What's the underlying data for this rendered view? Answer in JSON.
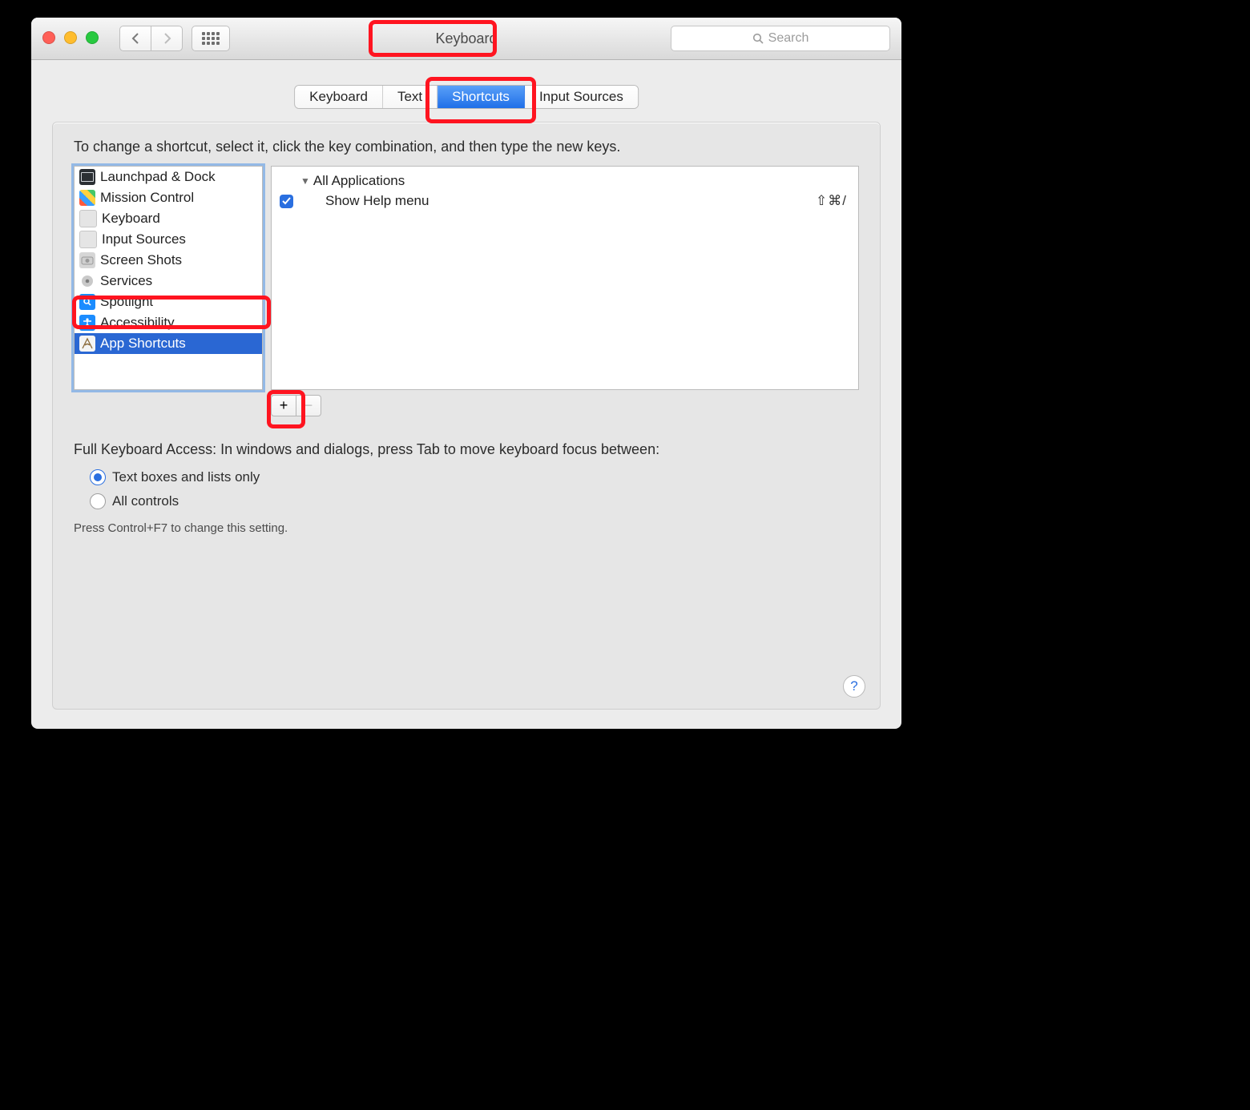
{
  "window": {
    "title": "Keyboard"
  },
  "search": {
    "placeholder": "Search"
  },
  "tabs": [
    {
      "label": "Keyboard",
      "selected": false
    },
    {
      "label": "Text",
      "selected": false
    },
    {
      "label": "Shortcuts",
      "selected": true
    },
    {
      "label": "Input Sources",
      "selected": false
    }
  ],
  "instruction": "To change a shortcut, select it, click the key combination, and then type the new keys.",
  "categories": [
    {
      "label": "Launchpad & Dock",
      "selected": false
    },
    {
      "label": "Mission Control",
      "selected": false
    },
    {
      "label": "Keyboard",
      "selected": false
    },
    {
      "label": "Input Sources",
      "selected": false
    },
    {
      "label": "Screen Shots",
      "selected": false
    },
    {
      "label": "Services",
      "selected": false
    },
    {
      "label": "Spotlight",
      "selected": false
    },
    {
      "label": "Accessibility",
      "selected": false
    },
    {
      "label": "App Shortcuts",
      "selected": true
    }
  ],
  "shortcuts": {
    "group": "All Applications",
    "items": [
      {
        "checked": true,
        "label": "Show Help menu",
        "keys": "⇧⌘/"
      }
    ]
  },
  "buttons": {
    "add": "+",
    "remove": "−"
  },
  "fullKeyboard": {
    "label": "Full Keyboard Access: In windows and dialogs, press Tab to move keyboard focus between:",
    "options": [
      {
        "label": "Text boxes and lists only",
        "checked": true
      },
      {
        "label": "All controls",
        "checked": false
      }
    ],
    "hint": "Press Control+F7 to change this setting."
  },
  "help": "?"
}
